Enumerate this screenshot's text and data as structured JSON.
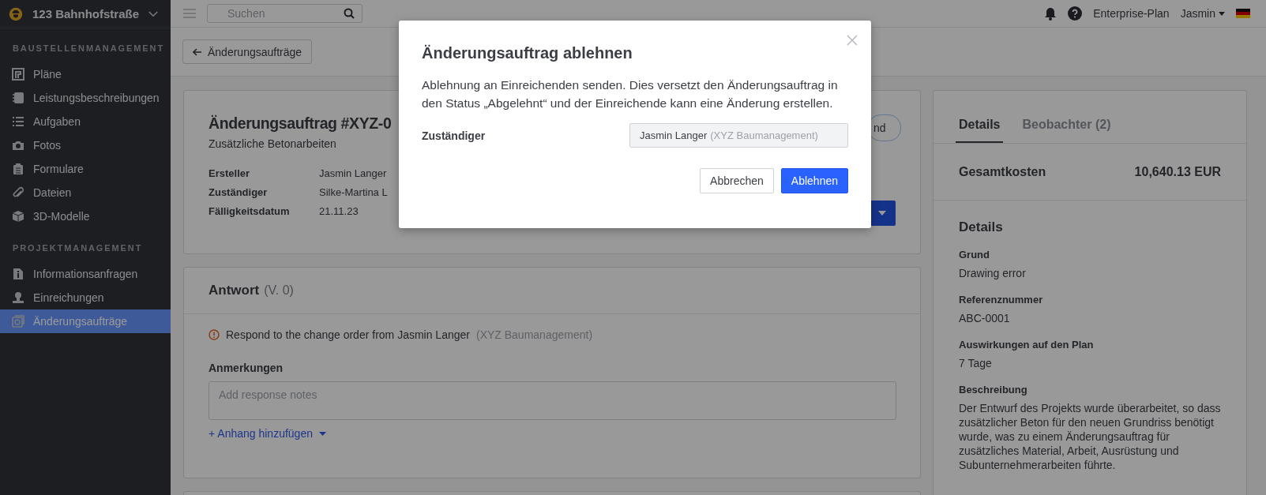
{
  "project": {
    "name": "123 Bahnhofstraße"
  },
  "search": {
    "placeholder": "Suchen"
  },
  "topbar": {
    "plan": "Enterprise-Plan",
    "user": "Jasmin"
  },
  "sidebar": {
    "sections": [
      {
        "heading": "BAUSTELLENMANAGEMENT",
        "items": [
          {
            "label": "Pläne",
            "selected": false
          },
          {
            "label": "Leistungsbeschreibungen",
            "selected": false
          },
          {
            "label": "Aufgaben",
            "selected": false
          },
          {
            "label": "Fotos",
            "selected": false
          },
          {
            "label": "Formulare",
            "selected": false
          },
          {
            "label": "Dateien",
            "selected": false
          },
          {
            "label": "3D-Modelle",
            "selected": false
          }
        ]
      },
      {
        "heading": "PROJEKTMANAGEMENT",
        "items": [
          {
            "label": "Informationsanfragen",
            "selected": false
          },
          {
            "label": "Einreichungen",
            "selected": false
          },
          {
            "label": "Änderungsaufträge",
            "selected": true
          }
        ]
      }
    ]
  },
  "back_button": "Änderungsaufträge",
  "change_order": {
    "title": "Änderungsauftrag #XYZ-0",
    "subtitle": "Zusätzliche Betonarbeiten",
    "status_pill": "nd",
    "fields": [
      {
        "label": "Ersteller",
        "value": "Jasmin Langer"
      },
      {
        "label": "Zuständiger",
        "value": "Silke-Martina L"
      },
      {
        "label": "Fälligkeitsdatum",
        "value": "21.11.23"
      }
    ]
  },
  "response": {
    "title": "Antwort",
    "version": "(V. 0)",
    "notice": "Respond to the change order from Jasmin Langer",
    "notice_company": "(XYZ Baumanagement)",
    "notes_label": "Anmerkungen",
    "notes_placeholder": "Add response notes",
    "attach_link": "+ Anhang hinzufügen"
  },
  "panel": {
    "tabs": [
      {
        "label": "Details",
        "selected": true
      },
      {
        "label": "Beobachter",
        "count": "(2)",
        "selected": false
      }
    ],
    "total_label": "Gesamtkosten",
    "total_value": "10,640.13 EUR",
    "heading": "Details",
    "items": [
      {
        "label": "Grund",
        "value": "Drawing error"
      },
      {
        "label": "Referenznummer",
        "value": "ABC-0001"
      },
      {
        "label": "Auswirkungen auf den Plan",
        "value": "7 Tage"
      },
      {
        "label": "Beschreibung",
        "value": "Der Entwurf des Projekts wurde überarbeitet, so dass zusätzlicher Beton für den neuen Grundriss benötigt wurde, was zu einem Änderungsauftrag für zusätzliches Material, Arbeit, Ausrüstung und Subunternehmerarbeiten führte."
      }
    ]
  },
  "dialog": {
    "title": "Änderungsauftrag ablehnen",
    "text": "Ablehnung an Einreichenden senden. Dies versetzt den Änderungsauftrag in den Status „Abgelehnt“ und der Einreichende kann eine Änderung erstellen.",
    "field_label": "Zuständiger",
    "field_value": "Jasmin Langer",
    "field_hint": "(XYZ Baumanagement)",
    "buttons": [
      {
        "label": "Abbrechen",
        "kind": "secondary"
      },
      {
        "label": "Ablehnen",
        "kind": "primary"
      }
    ]
  }
}
